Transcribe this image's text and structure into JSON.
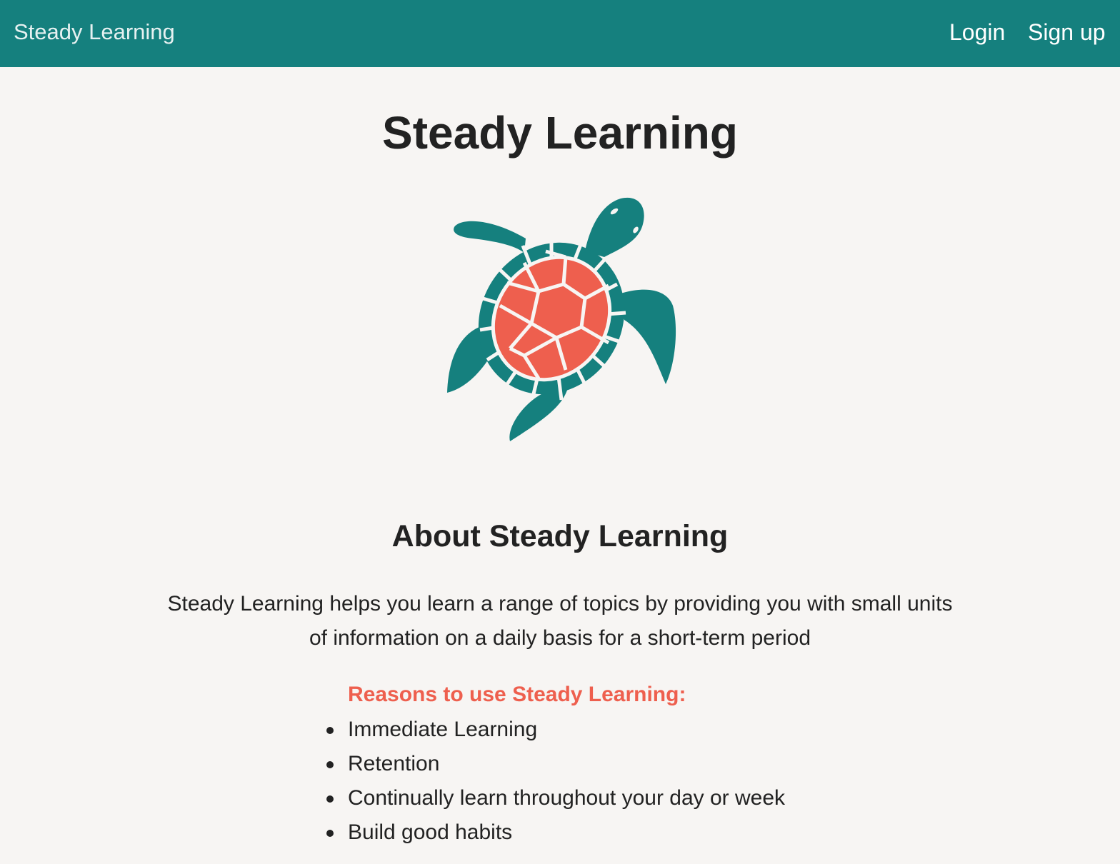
{
  "navbar": {
    "brand": "Steady Learning",
    "login": "Login",
    "signup": "Sign up"
  },
  "hero": {
    "title": "Steady Learning",
    "logo_icon": "sea-turtle-icon"
  },
  "about": {
    "heading": "About Steady Learning",
    "description": "Steady Learning helps you learn a range of topics by providing you with small units of information on a daily basis for a short-term period"
  },
  "reasons": {
    "heading": "Reasons to use Steady Learning:",
    "items": [
      "Immediate Learning",
      "Retention",
      "Continually learn throughout your day or week",
      "Build good habits"
    ]
  },
  "colors": {
    "navbar_bg": "#15807e",
    "page_bg": "#f7f5f3",
    "accent_coral": "#ee5f4e",
    "text": "#222222"
  }
}
